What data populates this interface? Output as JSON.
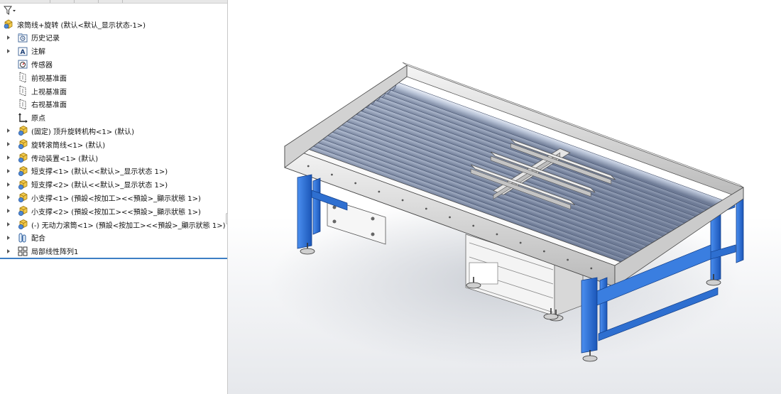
{
  "tree": {
    "root": "滚筒线+旋转  (默认<默认_显示状态-1>)",
    "items": [
      {
        "label": "历史记录",
        "icon": "history-folder-icon",
        "expandable": true
      },
      {
        "label": "注解",
        "icon": "annotation-icon",
        "expandable": true
      },
      {
        "label": "传感器",
        "icon": "sensor-icon",
        "expandable": false
      },
      {
        "label": "前视基准面",
        "icon": "plane-icon",
        "expandable": false
      },
      {
        "label": "上视基准面",
        "icon": "plane-icon",
        "expandable": false
      },
      {
        "label": "右视基准面",
        "icon": "plane-icon",
        "expandable": false
      },
      {
        "label": "原点",
        "icon": "origin-icon",
        "expandable": false
      },
      {
        "label": "(固定) 顶升旋转机构<1> (默认)",
        "icon": "subassembly-icon",
        "expandable": true
      },
      {
        "label": "旋转滚筒线<1> (默认)",
        "icon": "subassembly-icon",
        "expandable": true
      },
      {
        "label": "传动装置<1> (默认)",
        "icon": "subassembly-icon",
        "expandable": true
      },
      {
        "label": "短支撑<1> (默认<<默认>_显示状态 1>)",
        "icon": "subassembly-icon",
        "expandable": true
      },
      {
        "label": "短支撑<2> (默认<<默认>_显示状态 1>)",
        "icon": "subassembly-icon",
        "expandable": true
      },
      {
        "label": "小支撑<1> (預設<按加工><<預設>_顯示狀態 1>)",
        "icon": "subassembly-icon",
        "expandable": true
      },
      {
        "label": "小支撑<2> (預設<按加工><<預設>_顯示狀態 1>)",
        "icon": "subassembly-icon",
        "expandable": true
      },
      {
        "label": "(-) 无动力滚筒<1> (預設<按加工><<預設>_顯示狀態 1>)",
        "icon": "subassembly-icon",
        "expandable": true
      },
      {
        "label": "配合",
        "icon": "mates-icon",
        "expandable": true
      },
      {
        "label": "局部线性阵列1",
        "icon": "linear-pattern-icon",
        "expandable": true
      }
    ]
  },
  "model": {
    "description": "roller conveyor with lift-rotate module",
    "frame_color": "#dcdcdc",
    "leg_color": "#2e6fd0",
    "roller_color": "#b7c2d6"
  }
}
